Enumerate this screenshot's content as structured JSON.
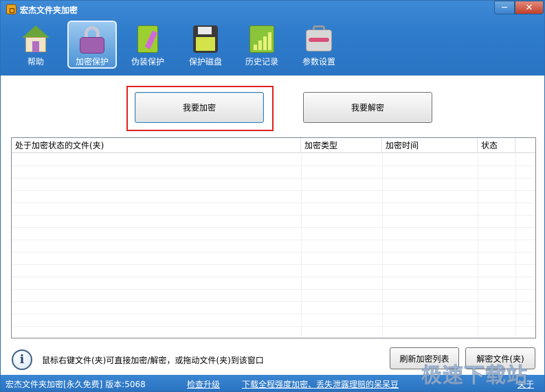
{
  "window": {
    "title": "宏杰文件夹加密"
  },
  "titlebar": {
    "minimize_glyph": "─",
    "close_glyph": "✕"
  },
  "toolbar": {
    "items": [
      {
        "label": "帮助",
        "icon": "house-icon",
        "active": false
      },
      {
        "label": "加密保护",
        "icon": "lock-icon",
        "active": true
      },
      {
        "label": "伪装保护",
        "icon": "book-icon",
        "active": false
      },
      {
        "label": "保护磁盘",
        "icon": "disk-icon",
        "active": false
      },
      {
        "label": "历史记录",
        "icon": "history-icon",
        "active": false
      },
      {
        "label": "参数设置",
        "icon": "toolbox-icon",
        "active": false
      }
    ]
  },
  "main": {
    "encrypt_button": "我要加密",
    "decrypt_button": "我要解密",
    "table": {
      "columns": [
        "处于加密状态的文件(夹)",
        "加密类型",
        "加密时间",
        "状态",
        ""
      ],
      "rows": []
    },
    "info_glyph": "i",
    "tip": "鼠标右键文件(夹)可直接加密/解密，或拖动文件(夹)到该窗口",
    "refresh_button": "刷新加密列表",
    "decrypt_folder_button": "解密文件(夹)"
  },
  "statusbar": {
    "app_version": "宏杰文件夹加密[永久免费]  版本:5068",
    "upgrade_link": "检查升级",
    "promo_link": "下载全程强度加密、丢失泄露理赔的呆呆豆",
    "about_link": "关于"
  },
  "watermark": "极速下载站",
  "colors": {
    "accent": "#2f7ccc",
    "highlight_border": "#e02020"
  }
}
